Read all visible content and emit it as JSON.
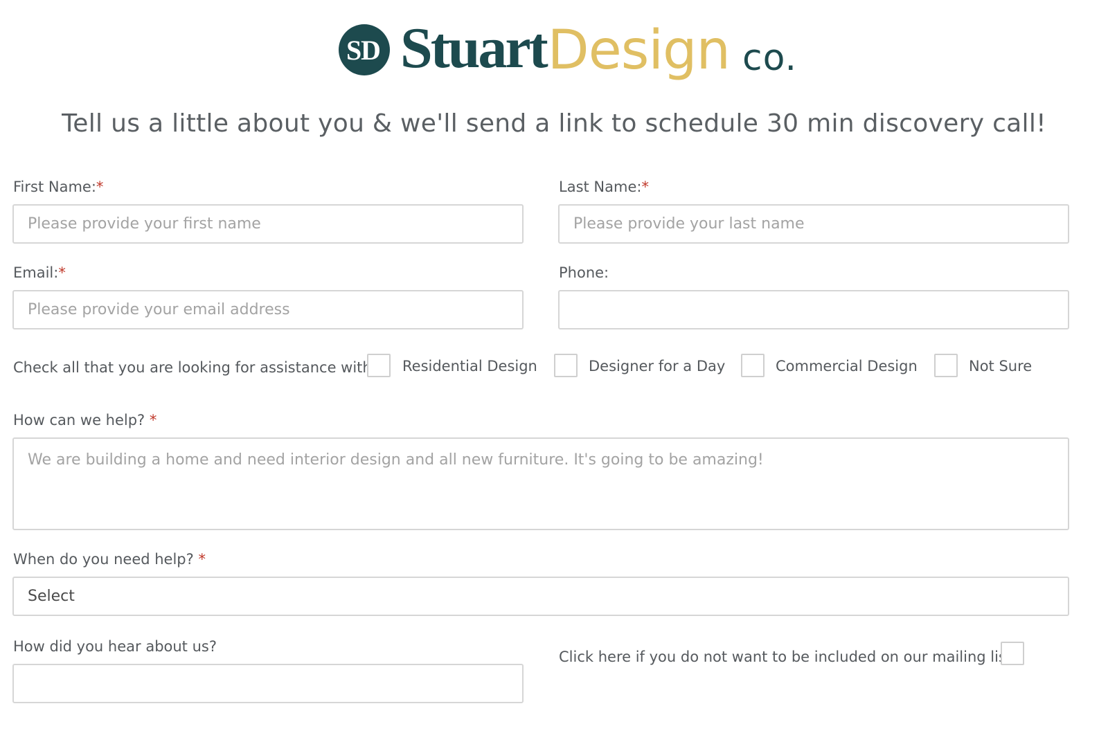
{
  "logo": {
    "monogram": "SD",
    "stuart": "Stuart",
    "design": "Design",
    "co": "co.",
    "colors": {
      "teal": "#1d4a4e",
      "gold": "#e0bf63"
    }
  },
  "headline": "Tell us a little about you & we'll send a link to schedule 30 min discovery call!",
  "form": {
    "first_name": {
      "label": "First Name:",
      "required_mark": "*",
      "placeholder": "Please provide your first name",
      "value": ""
    },
    "last_name": {
      "label": "Last Name:",
      "required_mark": "*",
      "placeholder": "Please provide your last name",
      "value": ""
    },
    "email": {
      "label": "Email:",
      "required_mark": "*",
      "placeholder": "Please provide your email address",
      "value": ""
    },
    "phone": {
      "label": "Phone:",
      "placeholder": "",
      "value": ""
    },
    "assistance": {
      "label": "Check all that you are looking for assistance with.",
      "options": [
        {
          "label": "Residential Design",
          "checked": false
        },
        {
          "label": "Designer for a Day",
          "checked": false
        },
        {
          "label": "Commercial Design",
          "checked": false
        },
        {
          "label": "Not Sure",
          "checked": false
        }
      ]
    },
    "how_help": {
      "label": "How can we help?",
      "required_mark": "*",
      "placeholder": "We are building a home and need interior design and all new furniture. It's going to be amazing!"
    },
    "when_help": {
      "label": "When do you need help?",
      "required_mark": "*",
      "selected": "Select"
    },
    "hear_about": {
      "label": "How did you hear about us?",
      "value": ""
    },
    "mailing_opt_out": {
      "label": "Click here if you do not want to be included on our mailing list",
      "checked": false
    }
  }
}
